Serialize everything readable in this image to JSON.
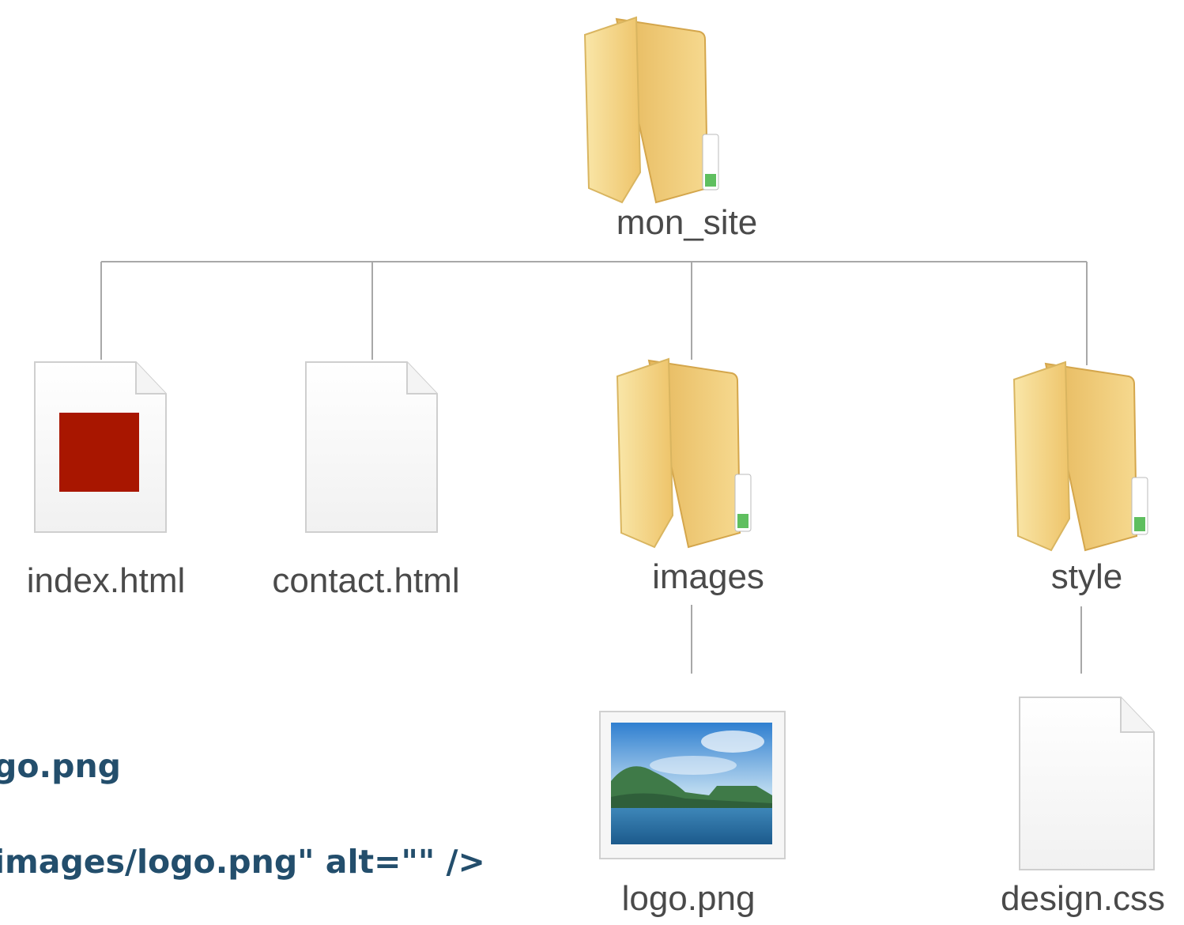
{
  "tree": {
    "root": {
      "label": "mon_site",
      "icon": "folder-icon"
    },
    "children": [
      {
        "label": "index.html",
        "icon": "html-file-icon",
        "marker_color": "#a81600"
      },
      {
        "label": "contact.html",
        "icon": "document-icon"
      },
      {
        "label": "images",
        "icon": "folder-icon",
        "children": [
          {
            "label": "logo.png",
            "icon": "image-file-icon"
          }
        ]
      },
      {
        "label": "style",
        "icon": "folder-icon",
        "children": [
          {
            "label": "design.css",
            "icon": "document-icon"
          }
        ]
      }
    ]
  },
  "code_snippet": {
    "line1": "go.png",
    "line2": "images/logo.png\" alt=\"\" />"
  },
  "colors": {
    "folder": "#f3cd73",
    "code_text": "#234e6c",
    "highlight": "#a81600",
    "connector": "#a8a8a8"
  }
}
